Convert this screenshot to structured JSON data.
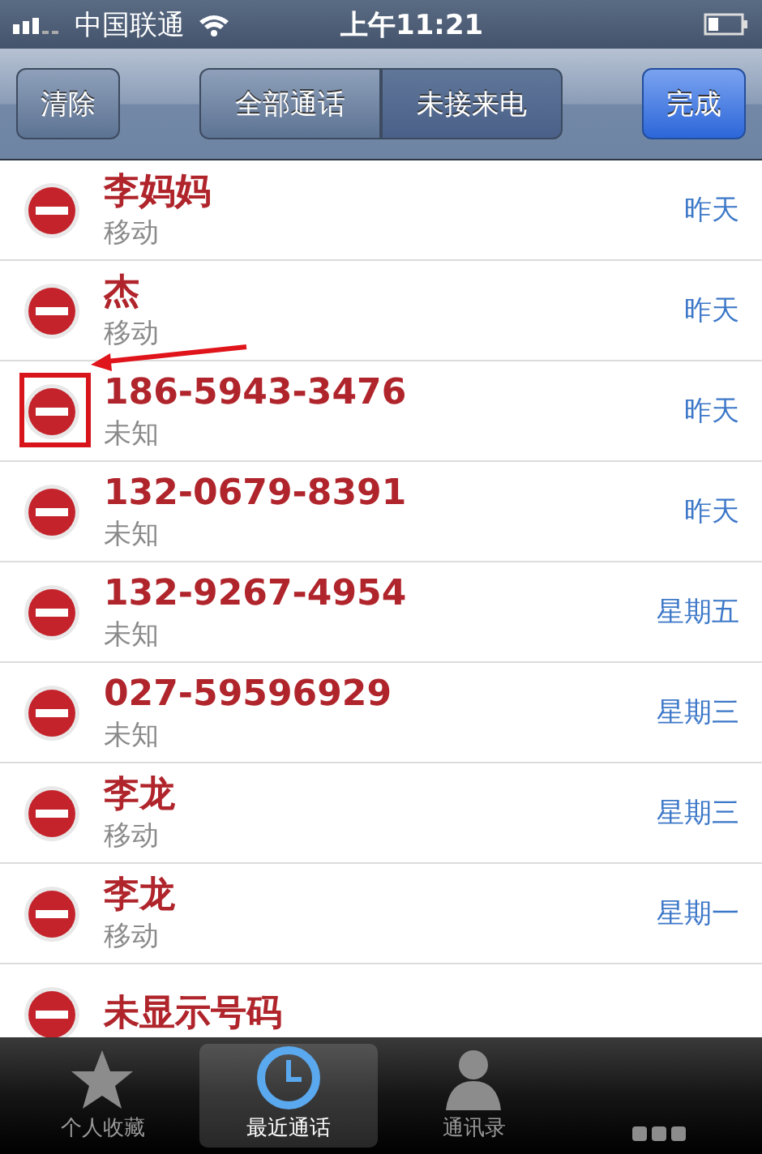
{
  "status_bar": {
    "carrier": "中国联通",
    "time": "上午11:21"
  },
  "nav_bar": {
    "clear_button": "清除",
    "segments": [
      {
        "label": "全部通话",
        "selected": false
      },
      {
        "label": "未接来电",
        "selected": true
      }
    ],
    "done_button": "完成"
  },
  "calls": [
    {
      "name": "李妈妈",
      "type": "移动",
      "date": "昨天"
    },
    {
      "name": "杰",
      "type": "移动",
      "date": "昨天"
    },
    {
      "name": "186-5943-3476",
      "type": "未知",
      "date": "昨天",
      "highlighted": true
    },
    {
      "name": "132-0679-8391",
      "type": "未知",
      "date": "昨天"
    },
    {
      "name": "132-9267-4954",
      "type": "未知",
      "date": "星期五"
    },
    {
      "name": "027-59596929",
      "type": "未知",
      "date": "星期三"
    },
    {
      "name": "李龙",
      "type": "移动",
      "date": "星期三"
    },
    {
      "name": "李龙",
      "type": "移动",
      "date": "星期一"
    },
    {
      "name": "未显示号码"
    }
  ],
  "tab_bar": [
    {
      "kind": "star",
      "label": "个人收藏",
      "selected": false
    },
    {
      "kind": "clock",
      "label": "最近通话",
      "selected": true
    },
    {
      "kind": "person",
      "label": "通讯录",
      "selected": false
    },
    {
      "kind": "keypad",
      "selected": false
    }
  ]
}
